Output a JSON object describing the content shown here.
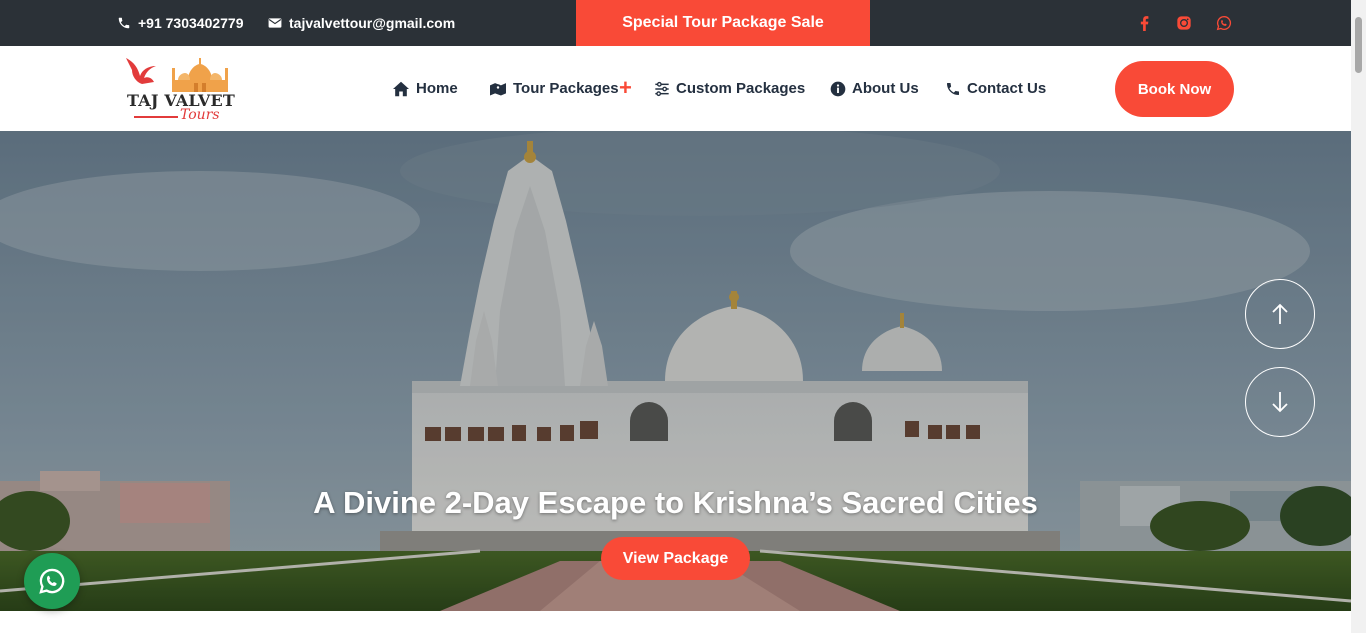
{
  "topbar": {
    "phone": "+91 7303402779",
    "email": "tajvalvettour@gmail.com",
    "sale_label": "Special Tour Package Sale",
    "social": [
      "facebook-icon",
      "instagram-icon",
      "whatsapp-icon"
    ]
  },
  "header": {
    "logo": {
      "brand": "TAJ VALVET",
      "script": "Tours"
    },
    "nav": [
      {
        "label": "Home",
        "icon": "home-icon"
      },
      {
        "label": "Tour Packages",
        "icon": "map-icon",
        "has_dropdown": true
      },
      {
        "label": "Custom Packages",
        "icon": "sliders-icon"
      },
      {
        "label": "About Us",
        "icon": "info-icon"
      },
      {
        "label": "Contact Us",
        "icon": "phone-icon"
      }
    ],
    "book_button": "Book Now"
  },
  "hero": {
    "title": "A Divine 2-Day Escape to Krishna’s Sacred Cities",
    "button": "View Package",
    "controls": [
      "arrow-up-icon",
      "arrow-down-icon"
    ]
  },
  "colors": {
    "accent": "#f94a37",
    "topbar_bg": "#2b3137",
    "nav_text": "#243040",
    "whatsapp": "#1f9d55"
  }
}
